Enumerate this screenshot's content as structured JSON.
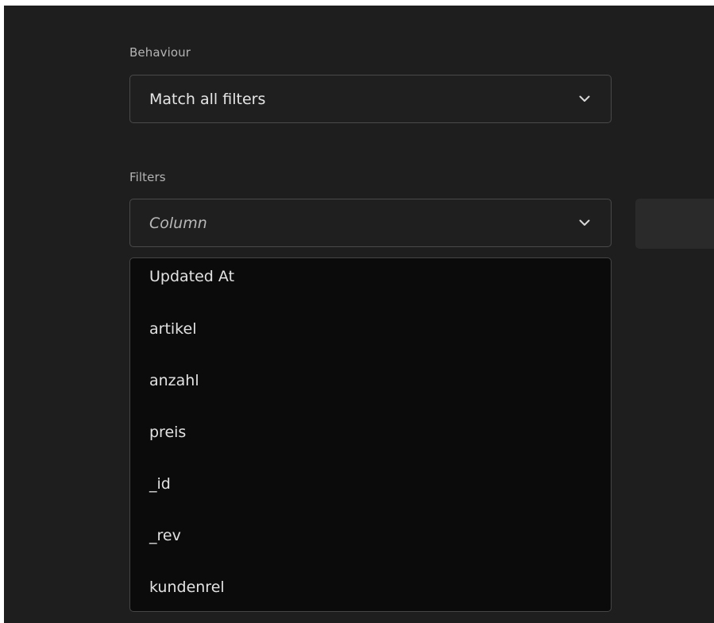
{
  "behaviour": {
    "label": "Behaviour",
    "selected": "Match all filters",
    "icon": "chevron-down-icon"
  },
  "filters": {
    "label": "Filters",
    "column_placeholder": "Column",
    "icon": "chevron-down-icon"
  },
  "dropdown": {
    "options": [
      "Updated At",
      "artikel",
      "anzahl",
      "preis",
      "_id",
      "_rev",
      "kundenrel"
    ]
  },
  "colors": {
    "panel_bg": "#1e1e1e",
    "dropdown_bg": "#0b0b0b",
    "border": "#4a4a4a",
    "text": "#e6e6e6"
  }
}
